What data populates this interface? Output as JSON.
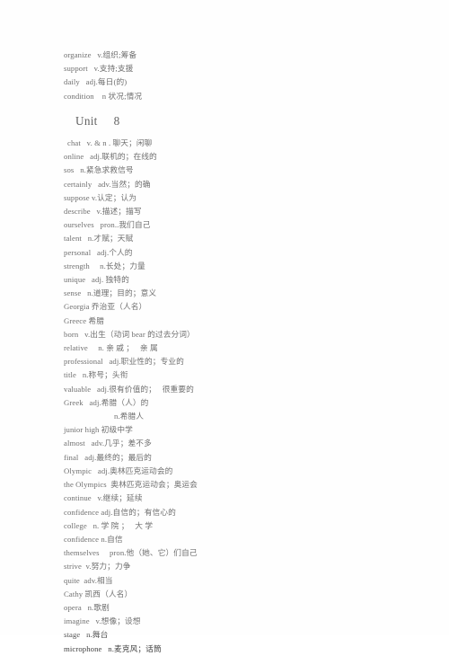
{
  "page": {
    "background_color": "#ffffff",
    "text_color": "#3f3f3f"
  },
  "top_entries": [
    "organize   v.组织;筹备",
    "support   v.支持;支援",
    "daily   adj.每日(的)",
    "condition    n 状况;情况"
  ],
  "unit_heading": "Unit     8",
  "vocabulary": [
    {
      "text": "chat   v. & n . 聊天；闲聊",
      "indent": "small"
    },
    {
      "text": "online   adj.联机的；在线的",
      "indent": "none"
    },
    {
      "text": "sos   n.紧急求救信号",
      "indent": "none"
    },
    {
      "text": "certainly   adv.当然；的确",
      "indent": "none"
    },
    {
      "text": "suppose v.认定；认为",
      "indent": "none"
    },
    {
      "text": "describe   v.描述；描写",
      "indent": "none"
    },
    {
      "text": "ourselves   pron..我们自己",
      "indent": "none"
    },
    {
      "text": "talent   n.才赋；天赋",
      "indent": "none"
    },
    {
      "text": "personal   adj.个人的",
      "indent": "none"
    },
    {
      "text": "strength     n.长处；力量",
      "indent": "none"
    },
    {
      "text": "unique   adj. 独特的",
      "indent": "none"
    },
    {
      "text": "sense   n.道理；目的；意义",
      "indent": "none"
    },
    {
      "text": "Georgia 乔治亚（人名）",
      "indent": "none"
    },
    {
      "text": "Greece 希腊",
      "indent": "none"
    },
    {
      "text": "born   v.出生（动词 bear 的过去分词）",
      "indent": "none"
    },
    {
      "text": "relative     n. 亲 戚 ；   亲 属",
      "indent": "none"
    },
    {
      "text": "professional   adj.职业性的；专业的",
      "indent": "none"
    },
    {
      "text": "title   n.称号；头衔",
      "indent": "none"
    },
    {
      "text": "valuable   adj.很有价值的；   很重要的",
      "indent": "none"
    },
    {
      "text": "Greek   adj.希腊（人）的",
      "indent": "none"
    },
    {
      "text": "n.希腊人",
      "indent": "cont"
    },
    {
      "text": "junior high 初级中学",
      "indent": "none"
    },
    {
      "text": "almost   adv.几乎；差不多",
      "indent": "none"
    },
    {
      "text": "final   adj.最终的；最后的",
      "indent": "none"
    },
    {
      "text": "Olympic   adj.奥林匹克运动会的",
      "indent": "none"
    },
    {
      "text": "the Olympics  奥林匹克运动会；奥运会",
      "indent": "none"
    },
    {
      "text": "continue   v.继续；延续",
      "indent": "none"
    },
    {
      "text": "confidence adj.自信的；有信心的",
      "indent": "none"
    },
    {
      "text": "college   n. 学 院 ；   大 学",
      "indent": "none"
    },
    {
      "text": "confidence n.自信",
      "indent": "none"
    },
    {
      "text": "themselves     pron.他（她、它）们自己",
      "indent": "none"
    },
    {
      "text": "strive  v.努力；力争",
      "indent": "none"
    },
    {
      "text": "quite  adv.相当",
      "indent": "none"
    },
    {
      "text": "Cathy 凯西（人名）",
      "indent": "none"
    },
    {
      "text": "opera   n.歌剧",
      "indent": "none"
    },
    {
      "text": "imagine   v.想像；设想",
      "indent": "none"
    },
    {
      "text": "stage   n.舞台",
      "indent": "none"
    },
    {
      "text": "microphone   n.麦克风；话筒",
      "indent": "none"
    }
  ]
}
